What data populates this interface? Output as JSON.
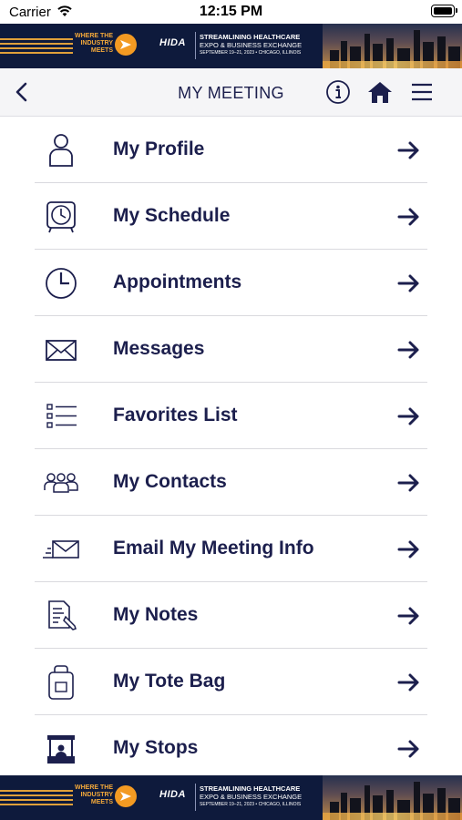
{
  "status_bar": {
    "carrier": "Carrier",
    "time": "12:15 PM"
  },
  "banner": {
    "tagline": "WHERE THE INDUSTRY MEETS",
    "org_logo_text": "HIDA",
    "event_line1": "STREAMLINING HEALTHCARE",
    "event_line2": "EXPO & BUSINESS EXCHANGE",
    "event_line3": "SEPTEMBER 19–21, 2023 • CHICAGO, ILLINOIS"
  },
  "nav": {
    "title": "MY MEETING",
    "back_icon": "chevron-left-icon",
    "info_icon": "info-icon",
    "home_icon": "home-icon",
    "menu_icon": "hamburger-icon"
  },
  "menu": {
    "items": [
      {
        "label": "My Profile",
        "icon": "person-icon"
      },
      {
        "label": "My Schedule",
        "icon": "alarm-clock-icon"
      },
      {
        "label": "Appointments",
        "icon": "clock-icon"
      },
      {
        "label": "Messages",
        "icon": "envelope-icon"
      },
      {
        "label": "Favorites List",
        "icon": "checklist-icon"
      },
      {
        "label": "My Contacts",
        "icon": "group-icon"
      },
      {
        "label": "Email My Meeting Info",
        "icon": "send-mail-icon"
      },
      {
        "label": "My Notes",
        "icon": "notes-icon"
      },
      {
        "label": "My Tote Bag",
        "icon": "tote-bag-icon"
      },
      {
        "label": "My Stops",
        "icon": "booth-icon"
      }
    ]
  },
  "colors": {
    "navy": "#1c1f4d",
    "banner_bg": "#0e1a3c",
    "accent_orange": "#f39a22",
    "divider": "#d9d9de"
  }
}
